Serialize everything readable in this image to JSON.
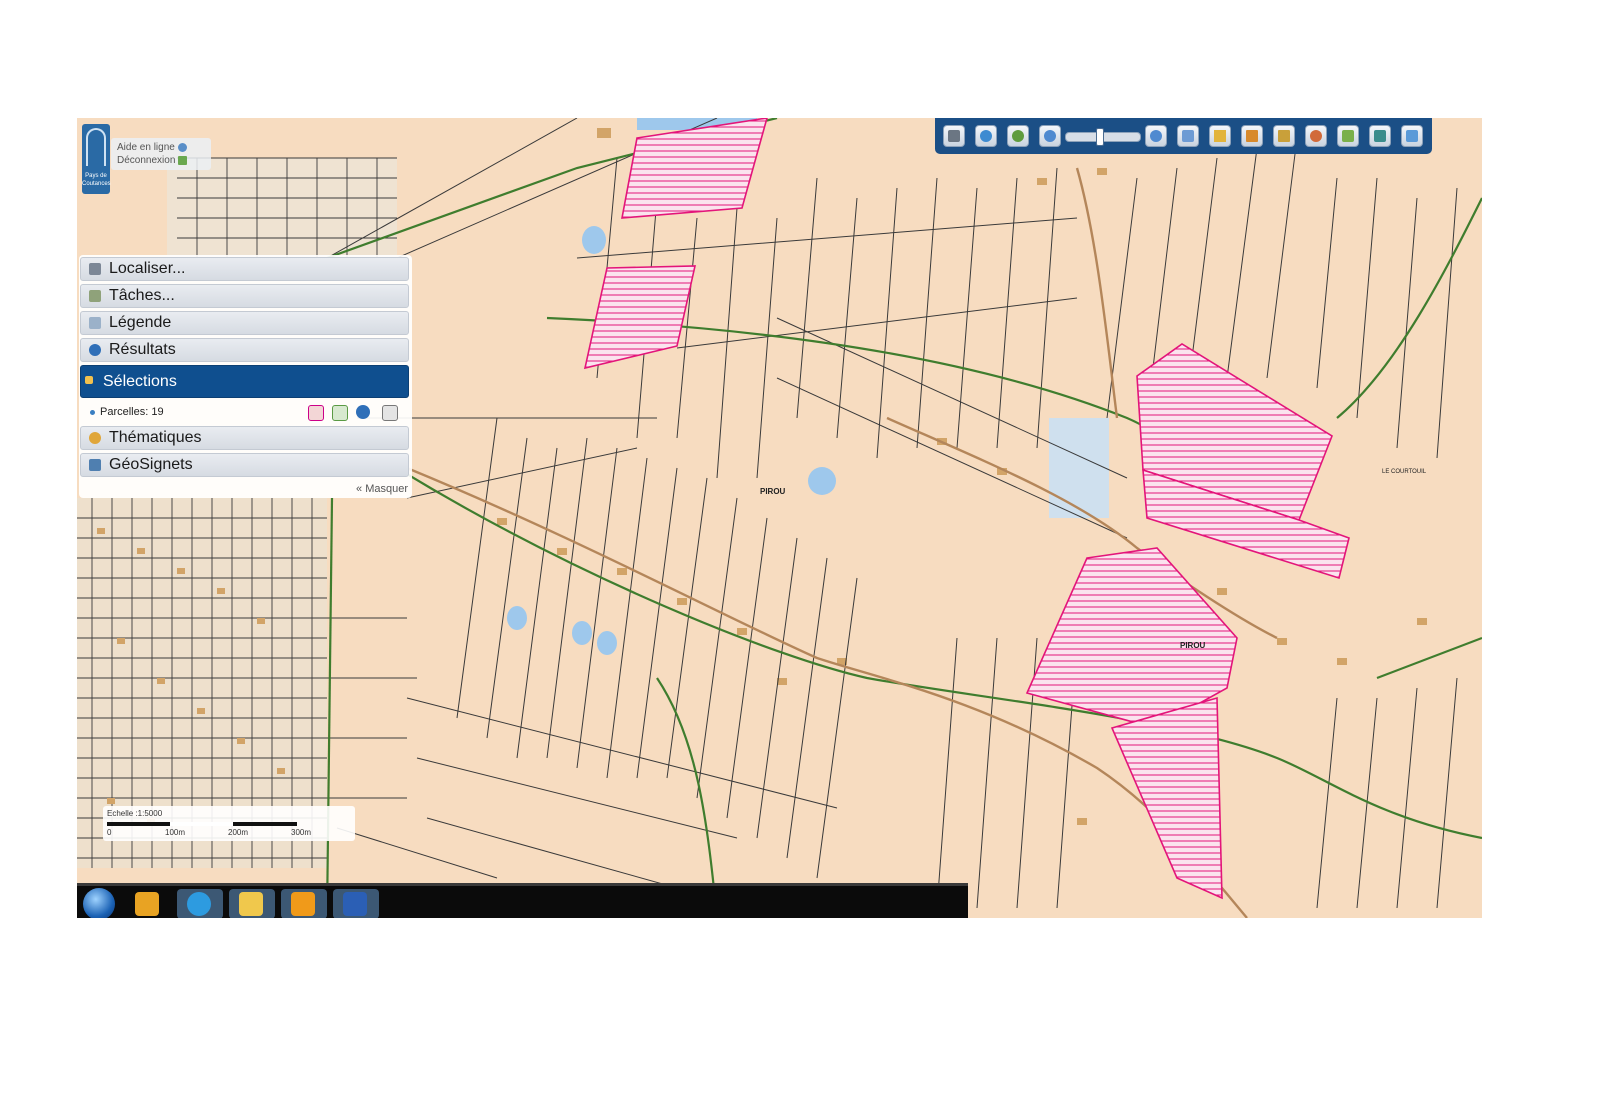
{
  "header": {
    "help_link": "Aide en ligne",
    "logout_link": "Déconnexion",
    "logo_text": "Pays de Coutances"
  },
  "panel": {
    "items": [
      {
        "label": "Localiser...",
        "icon": "binoculars-icon"
      },
      {
        "label": "Tâches...",
        "icon": "gears-icon"
      },
      {
        "label": "Légende",
        "icon": "legend-icon"
      },
      {
        "label": "Résultats",
        "icon": "info-icon"
      },
      {
        "label": "Sélections",
        "icon": "cursor-icon",
        "active": true
      },
      {
        "label": "Thématiques",
        "icon": "palette-icon"
      },
      {
        "label": "GéoSignets",
        "icon": "bookmark-icon"
      }
    ],
    "selection_row": {
      "label": "Parcelles: 19"
    },
    "hide_link": "« Masquer"
  },
  "toolbar": {
    "tools": [
      "print-icon",
      "globe-icon",
      "zoom-extent-icon",
      "zoom-out-icon",
      "zoom-in-icon",
      "zoom-box-icon",
      "measure-icon",
      "draw-icon",
      "edit-icon",
      "theme-icon",
      "layers-add-icon",
      "layers-icon",
      "map-add-icon"
    ],
    "zoom_level": 0.45
  },
  "map": {
    "place_labels": [
      "PIROU",
      "PIROU",
      "LE COURTOUIL"
    ],
    "colors": {
      "background": "#f7dcc0",
      "parcel": "#3a3a3a",
      "road": "#3f7d2e",
      "selection": "#e3157a",
      "water": "#9ec8ec",
      "building": "#d2a468"
    }
  },
  "scale": {
    "label": "Echelle :1:5000",
    "ticks": [
      "0",
      "100m",
      "200m",
      "300m"
    ]
  },
  "taskbar": {
    "apps": [
      "start-orb-icon",
      "media-player-icon",
      "internet-explorer-icon",
      "file-explorer-icon",
      "outlook-icon",
      "word-icon"
    ]
  }
}
